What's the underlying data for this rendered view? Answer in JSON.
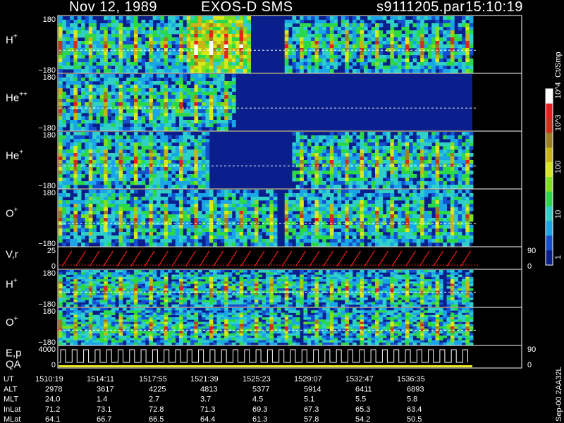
{
  "header": {
    "date": "Nov 12, 1989",
    "instrument": "EXOS-D SMS",
    "file": "s9111205.par",
    "time": "15:10:19"
  },
  "footer": {
    "stamp": "Sep-00 2AA32L"
  },
  "chart_data": {
    "type": "heatmap",
    "colorbar": {
      "label": "Ct/Smp",
      "ticks": [
        "1",
        "10",
        "100",
        "10^3",
        "10^4"
      ],
      "colors": [
        "#0a1f8c",
        "#1550d0",
        "#1aa6e6",
        "#2ed0c8",
        "#2bd84a",
        "#7fe01e",
        "#d9e81a",
        "#c8b414",
        "#9a8020",
        "#d03018",
        "#ee1c1c",
        "#ffffff"
      ]
    },
    "panels": [
      {
        "id": "h-plus",
        "label": "H",
        "sup": "+",
        "ymax": "180",
        "ymin": "−180",
        "kind": "spectrogram",
        "gap": [
          0.46,
          0.54
        ]
      },
      {
        "id": "he-plus-plus",
        "label": "He",
        "sup": "++",
        "ymax": "180",
        "ymin": "−180",
        "kind": "spectrogram",
        "gap": [
          0.42,
          1.0
        ]
      },
      {
        "id": "he-plus",
        "label": "He",
        "sup": "+",
        "ymax": "180",
        "ymin": "−180",
        "kind": "spectrogram",
        "gap": [
          0.36,
          0.56
        ]
      },
      {
        "id": "o-plus",
        "label": "O",
        "sup": "+",
        "ymax": "180",
        "ymin": "−180",
        "kind": "spectrogram",
        "gap": [
          0.52,
          0.54
        ]
      },
      {
        "id": "v-r",
        "label": "V,r",
        "sup": "",
        "ymax": "25",
        "ymin": "0",
        "kind": "line",
        "right_top": "90",
        "right_bottom": "0"
      },
      {
        "id": "h-plus-2",
        "label": "H",
        "sup": "+",
        "ymax": "180",
        "ymin": "−180",
        "kind": "spectrogram",
        "gap": [
          0.92,
          0.93
        ]
      },
      {
        "id": "o-plus-2",
        "label": "O",
        "sup": "+",
        "ymax": "180",
        "ymin": "−180",
        "kind": "spectrogram",
        "gap": [
          0.58,
          0.59
        ]
      },
      {
        "id": "e-p",
        "label": "E,p",
        "label2": "QA",
        "sup": "",
        "ymax": "4000",
        "ymin": "0",
        "kind": "step",
        "right_top": "90",
        "right_bottom": "0"
      }
    ],
    "ephemeris": [
      {
        "name": "UT",
        "values": [
          "1510:19",
          "1514:11",
          "1517:55",
          "1521:39",
          "1525:23",
          "1529:07",
          "1532:47",
          "1536:35"
        ]
      },
      {
        "name": "ALT",
        "values": [
          "2978",
          "3617",
          "4225",
          "4813",
          "5377",
          "5914",
          "6411",
          "6893"
        ]
      },
      {
        "name": "MLT",
        "values": [
          "24.0",
          "1.4",
          "2.7",
          "3.7",
          "4.5",
          "5.1",
          "5.5",
          "5.8"
        ]
      },
      {
        "name": "InLat",
        "values": [
          "71.2",
          "73.1",
          "72.8",
          "71.3",
          "69.3",
          "67.3",
          "65.3",
          "63.4"
        ]
      },
      {
        "name": "MLat",
        "values": [
          "64.1",
          "66.7",
          "66.5",
          "64.4",
          "61.3",
          "57.8",
          "54.2",
          "50.5"
        ]
      }
    ]
  }
}
